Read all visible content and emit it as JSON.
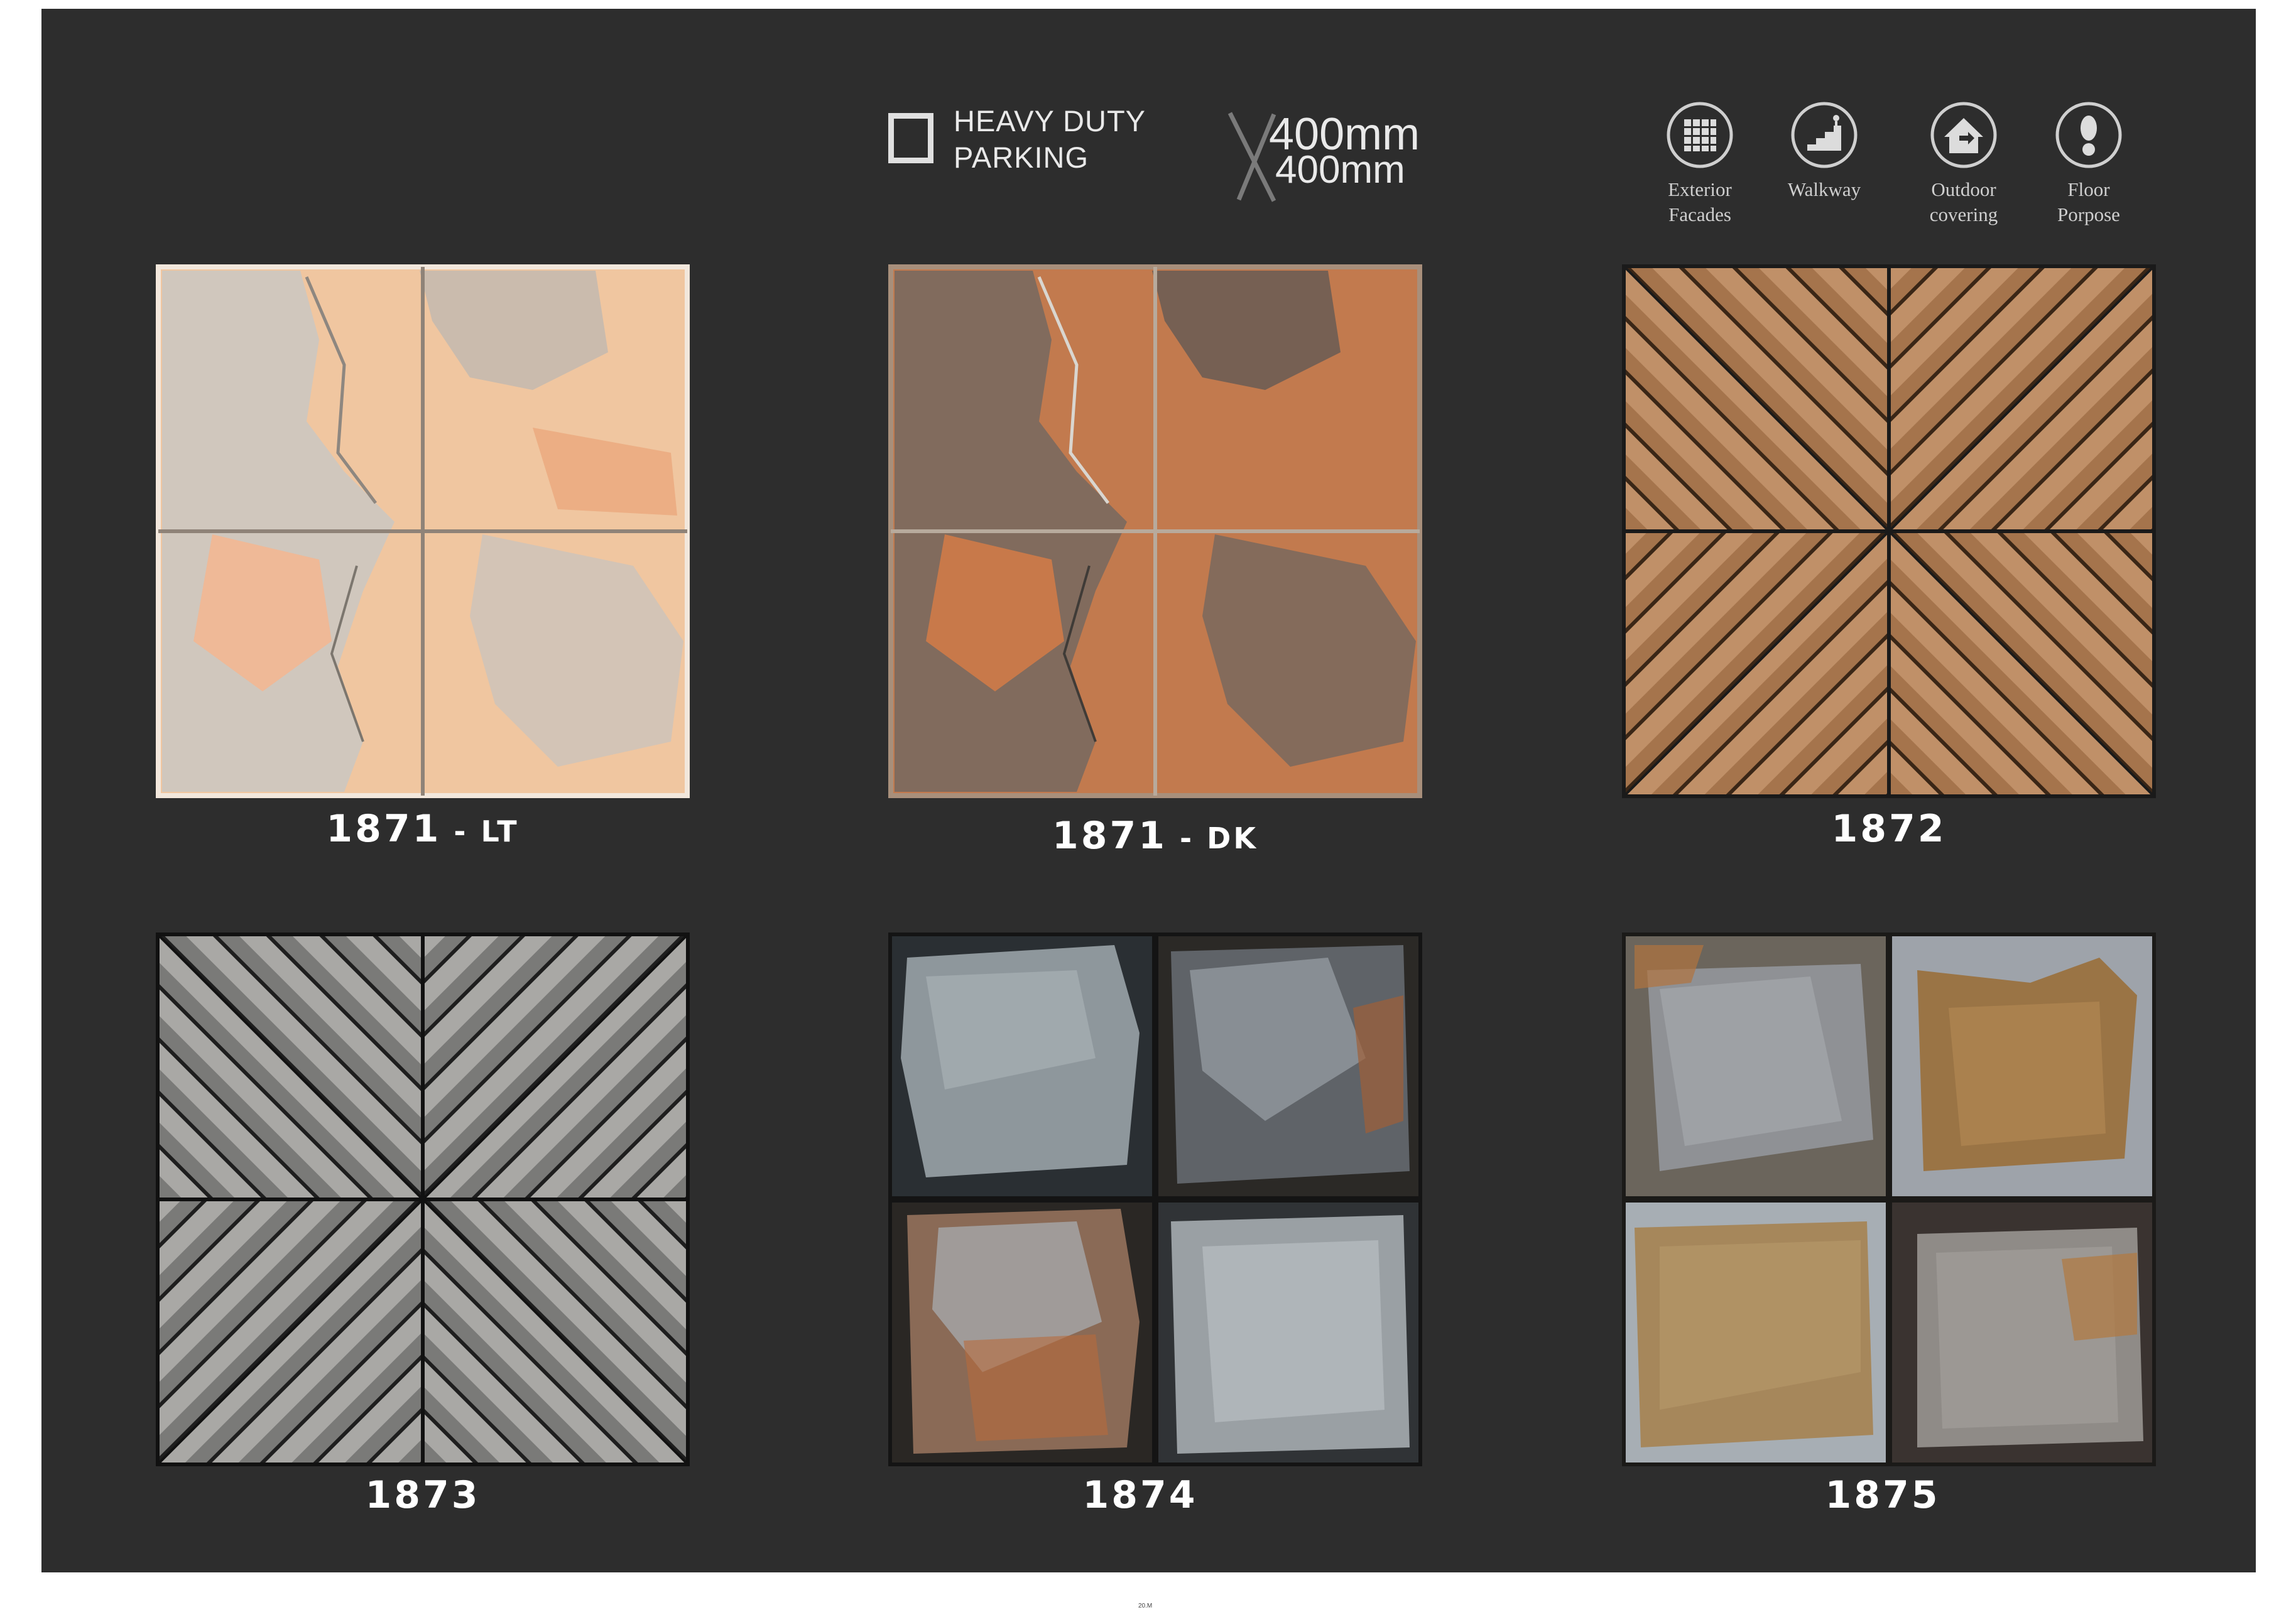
{
  "header": {
    "duty_line1": "HEAVY DUTY",
    "duty_line2": "PARKING",
    "duty_icon": "square-outline-icon",
    "size_line1": "400mm",
    "size_line2": "400mm",
    "size_icon": "x-multiply-icon"
  },
  "usage": [
    {
      "icon": "grid-facade-icon",
      "line1": "Exterior",
      "line2": "Facades"
    },
    {
      "icon": "stairs-walkway-icon",
      "line1": "Walkway",
      "line2": ""
    },
    {
      "icon": "house-outdoor-icon",
      "line1": "Outdoor",
      "line2": "covering"
    },
    {
      "icon": "footprint-floor-icon",
      "line1": "Floor",
      "line2": "Porpose"
    }
  ],
  "tiles": [
    {
      "code": "1871",
      "suffix": " - LT",
      "pattern": "slate-light"
    },
    {
      "code": "1871",
      "suffix": " - DK",
      "pattern": "slate-dark"
    },
    {
      "code": "1872",
      "suffix": "",
      "pattern": "wood-chevron-brown"
    },
    {
      "code": "1873",
      "suffix": "",
      "pattern": "wood-chevron-grey"
    },
    {
      "code": "1874",
      "suffix": "",
      "pattern": "stone-blocks-grey"
    },
    {
      "code": "1875",
      "suffix": "",
      "pattern": "stone-blocks-tan"
    }
  ],
  "footer": {
    "page_number": "20.M"
  },
  "colors": {
    "panel": "#2d2d2d",
    "text": "#ffffff",
    "muted_text": "#cfcfcf"
  }
}
